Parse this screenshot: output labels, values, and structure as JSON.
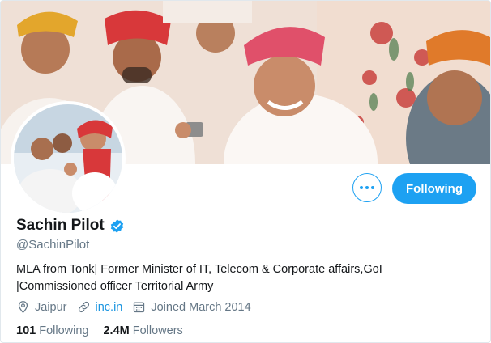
{
  "profile": {
    "name": "Sachin Pilot",
    "handle": "@SachinPilot",
    "bio_line1": "MLA from Tonk| Former Minister of IT, Telecom & Corporate affairs,GoI",
    "bio_line2": "|Commissioned officer Territorial Army",
    "location": "Jaipur",
    "website": "inc.in",
    "joined": "Joined March 2014",
    "verified": true
  },
  "actions": {
    "following_label": "Following"
  },
  "stats": {
    "following_count": "101",
    "following_label": "Following",
    "followers_count": "2.4M",
    "followers_label": "Followers"
  },
  "colors": {
    "accent": "#1da1f2",
    "link": "#1b95e0",
    "muted": "#657786",
    "text": "#14171a"
  },
  "icons": {
    "location": "location-pin-icon",
    "link": "link-icon",
    "calendar": "calendar-icon",
    "verified": "verified-badge-icon",
    "more": "more-options-icon"
  }
}
